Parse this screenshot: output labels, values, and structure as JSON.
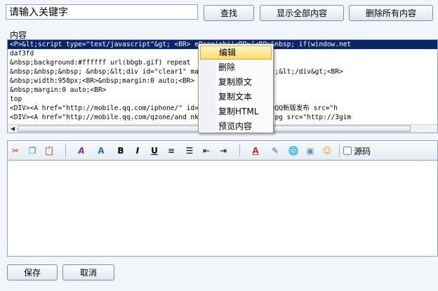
{
  "search": {
    "value": "请输入关键字"
  },
  "buttons": {
    "find": "查找",
    "show_all": "显示全部内容",
    "delete_all": "删除所有内容",
    "save": "保存",
    "cancel": "取消"
  },
  "content_label": "内容",
  "list_rows": [
    "<P>&lt;script type=\"text/javascript\"&gt; <BR>                     ePage(obj)<BR>{<BR>&nbsp; if(window.net",
    "daf3fd",
    "&nbsp;background:#ffffff url(bbgb.gif) repeat                        ",
    "&nbsp;&nbsp;&nbsp; &nbsp;&lt;div id=\"clear1\"              mages/blank.gif\" /&gt;&lt;/div&gt;<BR>",
    "&nbsp;width:958px;<BR>&nbsp;margin:0 auto;<BR>",
    "&nbsp;margin:0 auto;<BR>",
    "top",
    "<DIV><A href=\"http://mobile.qq.com/iphone/\"                id=show_img alt=iPhoneQQ新版发布 src=\"h",
    "<DIV><A href=\"http://mobile.qq.com/qzone/and                nk><IMG alt=banner8.jpg src=\"http://3gim"
  ],
  "context_menu": {
    "items": [
      "编辑",
      "删除",
      "复制原文",
      "复制文本",
      "复制HTML",
      "预览内容"
    ],
    "active_index": 0
  },
  "toolbar": {
    "tools": [
      {
        "name": "cut-icon",
        "glyph": "✂",
        "color": "#c0392b"
      },
      {
        "name": "copy-icon",
        "glyph": "❐",
        "color": "#2f6fbd"
      },
      {
        "name": "paste-icon",
        "glyph": "📋",
        "color": "#a0742b"
      },
      {
        "name": "font-family-icon",
        "glyph": "A",
        "color": "#7a2fa8"
      },
      {
        "name": "font-size-icon",
        "glyph": "A",
        "color": "#2f6fbd"
      },
      {
        "name": "bold-icon",
        "glyph": "B",
        "color": "#000000"
      },
      {
        "name": "italic-icon",
        "glyph": "I",
        "color": "#000000"
      },
      {
        "name": "underline-icon",
        "glyph": "U",
        "color": "#000000"
      },
      {
        "name": "align-icon",
        "glyph": "≡",
        "color": "#000000"
      },
      {
        "name": "list-icon",
        "glyph": "☰",
        "color": "#000000"
      },
      {
        "name": "outdent-icon",
        "glyph": "⇤",
        "color": "#000000"
      },
      {
        "name": "indent-icon",
        "glyph": "⇥",
        "color": "#000000"
      },
      {
        "name": "font-color-icon",
        "glyph": "A",
        "color": "#c0392b"
      },
      {
        "name": "highlight-icon",
        "glyph": "✎",
        "color": "#2f6fbd"
      },
      {
        "name": "link-icon",
        "glyph": "🌐",
        "color": "#2f6fbd"
      },
      {
        "name": "image-icon",
        "glyph": "▣",
        "color": "#6b8fb3"
      },
      {
        "name": "emoticon-icon",
        "glyph": "☺",
        "color": "#e0a800"
      }
    ],
    "source_label": "源码",
    "source_checked": false
  }
}
